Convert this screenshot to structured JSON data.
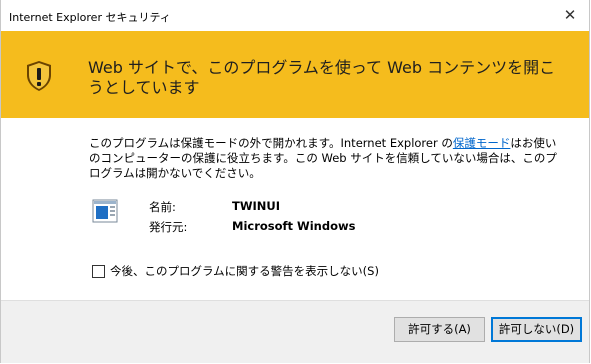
{
  "window": {
    "title": "Internet Explorer セキュリティ",
    "close_glyph": "✕"
  },
  "banner": {
    "icon": "shield-warning-icon",
    "color": "#f5bc1d",
    "headline": "Web サイトで、このプログラムを使って Web コンテンツを開こうとしています"
  },
  "body": {
    "text_before_link": "このプログラムは保護モードの外で開かれます。Internet Explorer の",
    "link_text": "保護モード",
    "text_after_link": "はお使いのコンピューターの保護に役立ちます。この Web サイトを信頼していない場合は、このプログラムは開かないでください。",
    "app_icon": "application-window-icon",
    "name_label": "名前:",
    "name_value": "TWINUI",
    "publisher_label": "発行元:",
    "publisher_value": "Microsoft Windows",
    "checkbox_label": "今後、このプログラムに関する警告を表示しない(S)",
    "checkbox_checked": false
  },
  "buttons": {
    "allow": "許可する(A)",
    "deny": "許可しない(D)"
  }
}
